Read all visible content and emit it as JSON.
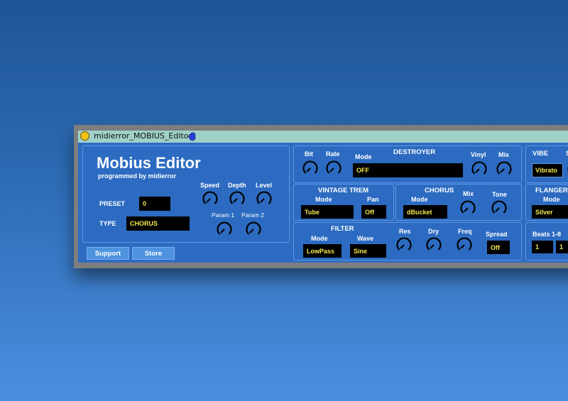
{
  "window": {
    "title": "midierror_MOBIUS_Editor"
  },
  "main": {
    "title": "Mobius Editor",
    "subtitle": "programmed by midierror",
    "preset_label": "PRESET",
    "preset_value": "0",
    "type_label": "TYPE",
    "type_value": "CHORUS",
    "knob_labels": {
      "speed": "Speed",
      "depth": "Depth",
      "level": "Level",
      "param1": "Param 1",
      "param2": "Param 2"
    }
  },
  "buttons": {
    "support": "Support",
    "store": "Store"
  },
  "destroyer": {
    "title": "DESTROYER",
    "bit": "Bit",
    "rate": "Rate",
    "mode_label": "Mode",
    "mode_value": "OFF",
    "vinyl": "Vinyl",
    "mix": "Mix"
  },
  "vibe": {
    "title": "VIBE",
    "s_label": "S",
    "mode_value": "Vibrato"
  },
  "vintage_trem": {
    "title": "VINTAGE TREM",
    "mode_label": "Mode",
    "mode_value": "Tube",
    "pan_label": "Pan",
    "pan_value": "Off"
  },
  "chorus": {
    "title": "CHORUS",
    "mode_label": "Mode",
    "mode_value": "dBucket",
    "mix": "Mix",
    "tone": "Tone"
  },
  "flanger": {
    "title": "FLANGER",
    "mode_label": "Mode",
    "mode_value": "Silver"
  },
  "filter": {
    "title": "FILTER",
    "mode_label": "Mode",
    "mode_value": "LowPass",
    "wave_label": "Wave",
    "wave_value": "Sine",
    "res": "Res",
    "dry": "Dry",
    "freq": "Freq",
    "spread_label": "Spread",
    "spread_value": "Off"
  },
  "beats": {
    "title": "Beats 1-8",
    "value1": "1",
    "value2": "1"
  },
  "colors": {
    "background": "#2e6cc3",
    "field_text": "#f6e94a",
    "titlebar": "#9fd1c8",
    "button": "#4f93de"
  }
}
